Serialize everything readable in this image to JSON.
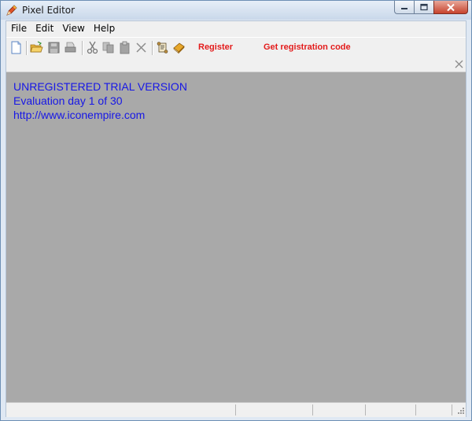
{
  "window": {
    "title": "Pixel Editor"
  },
  "menu": [
    "File",
    "Edit",
    "View",
    "Help"
  ],
  "toolbar": {
    "register_label": "Register",
    "get_code_label": "Get registration code",
    "link_color": "#e31b1b",
    "icons": [
      "new-file-icon",
      "open-folder-icon",
      "save-icon",
      "print-icon",
      "cut-icon",
      "copy-icon",
      "paste-icon",
      "delete-icon",
      "scroll-icon",
      "book-icon"
    ]
  },
  "canvas": {
    "background": "#a9a9a9",
    "lines": [
      "UNREGISTERED TRIAL VERSION",
      "Evaluation day 1 of 30",
      "http://www.iconempire.com"
    ],
    "text_color": "#1717e6"
  }
}
